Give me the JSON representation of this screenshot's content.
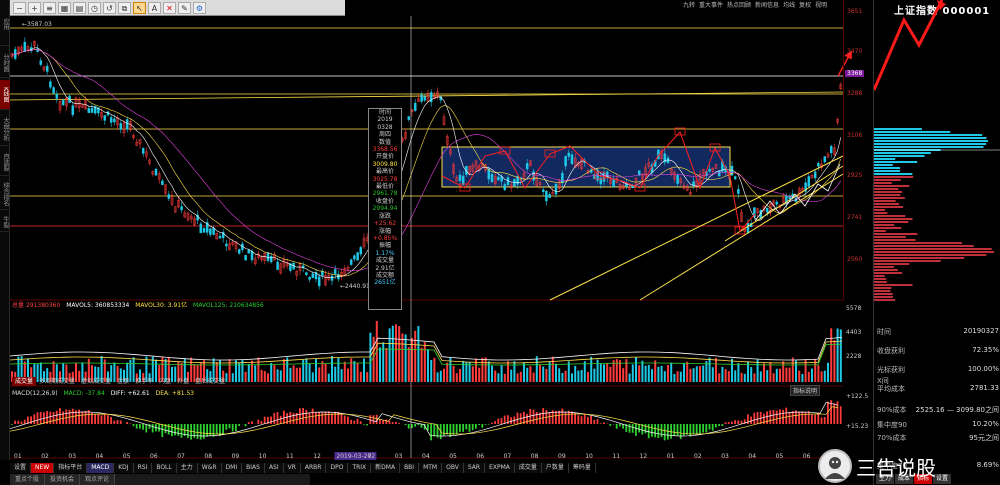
{
  "left_tabs": [
    "应用",
    "分时图",
    "K线图",
    "大盘分析",
    "自选股",
    "综合排名",
    "牛股"
  ],
  "toolbar": {
    "icons": [
      "minus-icon",
      "plus-icon",
      "bars-icon",
      "grid-icon",
      "fill-icon",
      "timer-icon",
      "history-icon",
      "copy-icon",
      "cursor-icon",
      "text-icon",
      "delete-icon",
      "draw-icon",
      "gear-icon"
    ]
  },
  "top_menu": [
    "九转",
    "重大事件",
    "热点回顾",
    "新闻信息",
    "均线",
    "复权",
    "视明"
  ],
  "price_axis": {
    "labels": [
      "3651",
      "3470",
      "3288",
      "3106",
      "2925",
      "2741",
      "2560"
    ],
    "current_label": "3368",
    "high_label": "3587.03",
    "low_label": "2440.91"
  },
  "volume_axis": [
    "5578",
    "4403",
    "2228"
  ],
  "macd_axis": [
    "+122.5",
    "+15.23"
  ],
  "right_panel": {
    "title": "上证指数 000001",
    "rows": [
      {
        "k": "时间",
        "v": "20190327"
      },
      {
        "k": "收盘获利",
        "v": "72.35%"
      },
      {
        "k": "光标获利",
        "v": "100.00%"
      },
      {
        "k": "X间",
        "v": ""
      },
      {
        "k": "平均成本",
        "v": "2781.33"
      }
    ],
    "cost_row": {
      "k": "90%成本",
      "v": "2525.16 — 3099.80之间"
    },
    "concentration_rows": [
      {
        "k": "集中度90",
        "v": "10.20%"
      },
      {
        "k": "70%成本",
        "v": "95元之间"
      },
      {
        "k": "集中度70",
        "v": "8.69%"
      }
    ],
    "bottom_buttons": [
      "主力",
      "成本",
      "指标",
      "设置"
    ]
  },
  "info_box": {
    "lines": [
      {
        "t": "时间",
        "c": ""
      },
      {
        "t": "2019",
        "c": ""
      },
      {
        "t": "0328",
        "c": ""
      },
      {
        "t": "周四",
        "c": ""
      },
      {
        "t": "数值",
        "c": ""
      },
      {
        "t": "3368.56",
        "c": "r"
      },
      {
        "t": "开盘价",
        "c": ""
      },
      {
        "t": "3009.80",
        "c": "y"
      },
      {
        "t": "最高价",
        "c": ""
      },
      {
        "t": "3025.78",
        "c": "r"
      },
      {
        "t": "最低价",
        "c": ""
      },
      {
        "t": "2961.78",
        "c": "g"
      },
      {
        "t": "收盘价",
        "c": ""
      },
      {
        "t": "2994.94",
        "c": "g"
      },
      {
        "t": "涨跌",
        "c": ""
      },
      {
        "t": "+25.62",
        "c": "r"
      },
      {
        "t": "涨幅",
        "c": ""
      },
      {
        "t": "+0.85%",
        "c": "r"
      },
      {
        "t": "振幅",
        "c": ""
      },
      {
        "t": "1.17%",
        "c": "c"
      },
      {
        "t": "成交量",
        "c": ""
      },
      {
        "t": "2.91亿",
        "c": ""
      },
      {
        "t": "成交额",
        "c": ""
      },
      {
        "t": "2651亿",
        "c": "c"
      }
    ]
  },
  "volume_legend": {
    "label": "总量",
    "value": "291380360",
    "ma5": "MAVOL5: 360853334",
    "ma30": "MAVOL30: 3.91亿",
    "ma125": "MAVOL125: 210634856"
  },
  "macd_legend": {
    "label": "MACD(12,26,9)",
    "macd": "MACD: -37.84",
    "diff": "DIFF: +62.61",
    "dea": "DEA: +81.53"
  },
  "indicator_tabs": {
    "upper": [
      "成交量",
      "多周期成交量",
      "虚拟成交量",
      "金额",
      "换手率",
      "内盘",
      "外盘",
      "盘后成交量"
    ],
    "indicator_label": "指标说明"
  },
  "lower_tabs": [
    "设置",
    "NEW",
    "指标平台",
    "MACD",
    "KDJ",
    "RSI",
    "BOLL",
    "主力",
    "W&R",
    "DMI",
    "BIAS",
    "ASI",
    "VR",
    "ARBR",
    "DPO",
    "TRIX",
    "新DMA",
    "BBI",
    "MTM",
    "OBV",
    "SAR",
    "EXPMA",
    "成交量",
    "户数量",
    "筹码量"
  ],
  "bottom_tabs": [
    "重点个股",
    "投资机会",
    "观点评论"
  ],
  "x_axis_labels": [
    "01",
    "02",
    "03",
    "04",
    "05",
    "06",
    "07",
    "08",
    "09",
    "10",
    "11",
    "12",
    "2019-03-27",
    "02",
    "03",
    "04",
    "05",
    "06",
    "07",
    "08",
    "09",
    "10",
    "11",
    "12",
    "01",
    "02",
    "03",
    "04",
    "05",
    "06",
    "07"
  ],
  "date_marker": "2019-03-27",
  "watermark": {
    "text": "三告说股"
  },
  "colors": {
    "up": "#ff3b3b",
    "down": "#1ec8e6",
    "ma": "#ffe14a",
    "box_fill": "#14306e",
    "accent": "#ff2020"
  }
}
